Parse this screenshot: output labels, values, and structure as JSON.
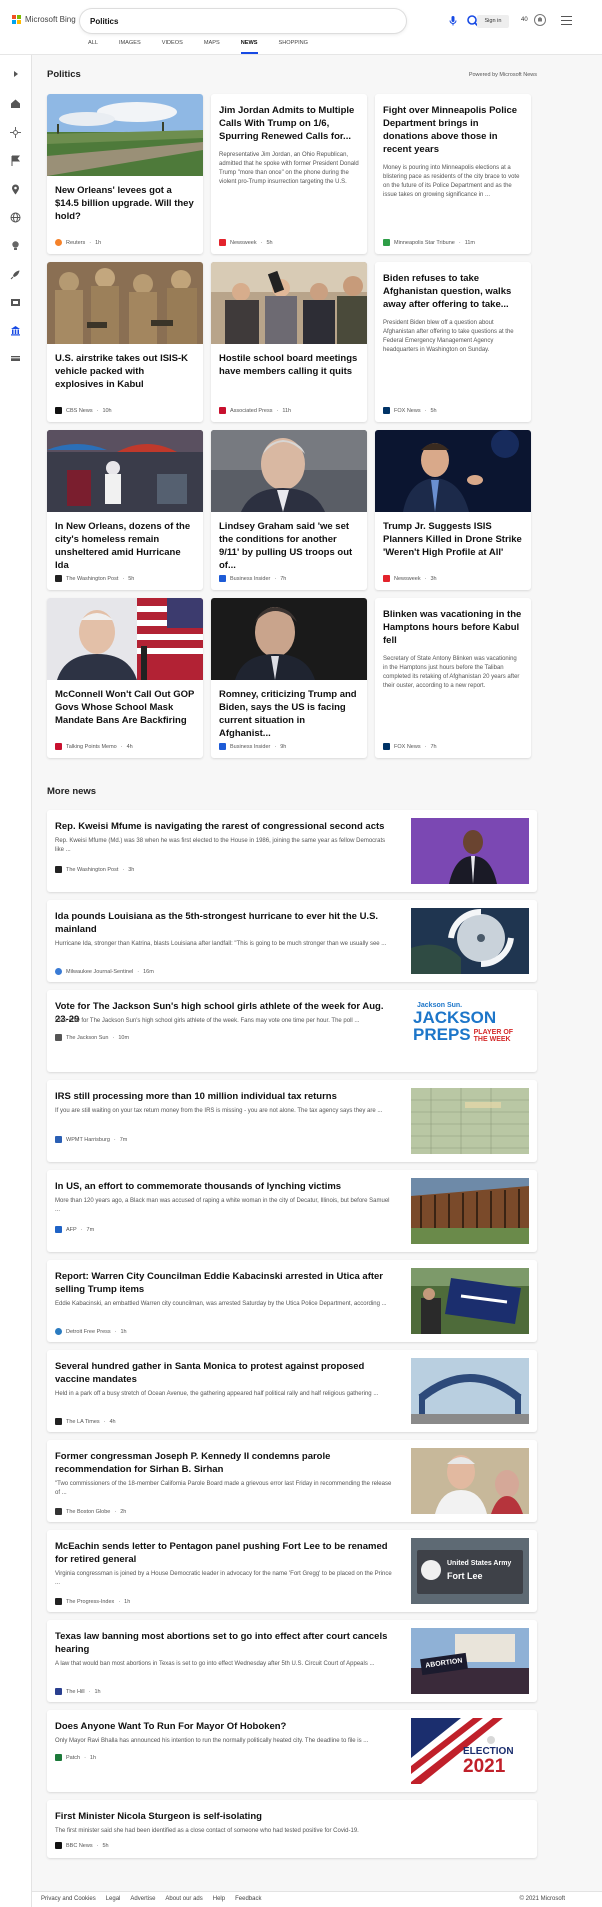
{
  "header": {
    "logo_text": "Microsoft Bing",
    "logo_colors": [
      "#f25022",
      "#7fba00",
      "#00a4ef",
      "#ffb900"
    ],
    "search_value": "Politics",
    "tabs": [
      {
        "label": "ALL",
        "active": false
      },
      {
        "label": "IMAGES",
        "active": false
      },
      {
        "label": "VIDEOS",
        "active": false
      },
      {
        "label": "MAPS",
        "active": false
      },
      {
        "label": "NEWS",
        "active": true
      },
      {
        "label": "SHOPPING",
        "active": false
      }
    ],
    "signin_label": "Sign in",
    "rewards_points": "40",
    "accent_color": "#174ae4"
  },
  "sidebar": {
    "icons": [
      "expand-icon",
      "home-icon",
      "crosshair-icon",
      "flag-icon",
      "location-pin-icon",
      "globe-icon",
      "lightbulb-icon",
      "rocket-icon",
      "film-icon",
      "politics-building-icon",
      "money-icon"
    ]
  },
  "main": {
    "section_title": "Politics",
    "powered_by": "Powered by Microsoft News",
    "cards": [
      {
        "title": "New Orleans' levees got a $14.5 billion upgrade. Will they hold?",
        "source": "Reuters",
        "age": "1h",
        "has_image": true,
        "image": "levee-photo",
        "src_color": "#f5822a"
      },
      {
        "title": "Jim Jordan Admits to Multiple Calls With Trump on 1/6, Spurring Renewed Calls for...",
        "desc": "Representative Jim Jordan, an Ohio Republican, admitted that he spoke with former President Donald Trump \"more than once\" on the phone during the violent pro-Trump insurrection targeting the U.S.",
        "source": "Newsweek",
        "age": "5h",
        "has_image": false,
        "src_color": "#e3232c"
      },
      {
        "title": "Fight over Minneapolis Police Department brings in donations above those in recent years",
        "desc": "Money is pouring into Minneapolis elections at a blistering pace as residents of the city brace to vote on the future of its Police Department and as the issue takes on growing significance in ...",
        "source": "Minneapolis Star Tribune",
        "age": "11m",
        "has_image": false,
        "src_color": "#2e9e47"
      },
      {
        "title": "U.S. airstrike takes out ISIS-K vehicle packed with explosives in Kabul",
        "source": "CBS News",
        "age": "10h",
        "has_image": true,
        "image": "soldiers-photo",
        "src_color": "#111111"
      },
      {
        "title": "Hostile school board meetings have members calling it quits",
        "source": "Associated Press",
        "age": "11h",
        "has_image": true,
        "image": "meeting-photo",
        "src_color": "#c8102e"
      },
      {
        "title": "Biden refuses to take Afghanistan question, walks away after offering to take...",
        "desc": "President Biden blew off a question about Afghanistan after offering to take questions at the Federal Emergency Management Agency headquarters in Washington on Sunday.",
        "source": "FOX News",
        "age": "5h",
        "has_image": false,
        "src_color": "#003366"
      },
      {
        "title": "In New Orleans, dozens of the city's homeless remain unsheltered amid Hurricane Ida",
        "source": "The Washington Post",
        "age": "5h",
        "has_image": true,
        "image": "homeless-photo",
        "src_color": "#222222"
      },
      {
        "title": "Lindsey Graham said 'we set the conditions for another 9/11' by pulling US troops out of...",
        "source": "Business Insider",
        "age": "7h",
        "has_image": true,
        "image": "graham-photo",
        "src_color": "#1d5bd6"
      },
      {
        "title": "Trump Jr. Suggests ISIS Planners Killed in Drone Strike 'Weren't High Profile at All'",
        "source": "Newsweek",
        "age": "3h",
        "has_image": true,
        "image": "trumpjr-photo",
        "src_color": "#e3232c"
      },
      {
        "title": "McConnell Won't Call Out GOP Govs Whose School Mask Mandate Bans Are Backfiring",
        "source": "Talking Points Memo",
        "age": "4h",
        "has_image": true,
        "image": "mcconnell-photo",
        "src_color": "#c8102e"
      },
      {
        "title": "Romney, criticizing Trump and Biden, says the US is facing current situation in Afghanist...",
        "source": "Business Insider",
        "age": "9h",
        "has_image": true,
        "image": "romney-photo",
        "src_color": "#1d5bd6"
      },
      {
        "title": "Blinken was vacationing in the Hamptons hours before Kabul fell",
        "desc": "Secretary of State Antony Blinken was vacationing in the Hamptons just hours before the Taliban completed its retaking of Afghanistan 20 years after their ouster, according to a new report.",
        "source": "FOX News",
        "age": "7h",
        "has_image": false,
        "src_color": "#003366"
      }
    ],
    "more_title": "More news",
    "more": [
      {
        "title": "Rep. Kweisi Mfume is navigating the rarest of congressional second acts",
        "desc": "Rep. Kweisi Mfume (Md.) was 38 when he was first elected to the House in 1986, joining the same year as fellow Democrats like ...",
        "source": "The Washington Post",
        "age": "3h",
        "image": "mfume-photo",
        "src_color": "#222222"
      },
      {
        "title": "Ida pounds Louisiana as the 5th-strongest hurricane to ever hit the U.S. mainland",
        "desc": "Hurricane Ida, stronger than Katrina, blasts Louisiana after landfall: \"This is going to be much stronger than we usually see ...",
        "source": "Milwaukee Journal-Sentinel",
        "age": "16m",
        "image": "hurricane-photo",
        "src_color": "#3a7bd5"
      },
      {
        "title": "Vote for The Jackson Sun's high school girls athlete of the week for Aug. 23-29",
        "desc": "Vote now for The Jackson Sun's high school girls athlete of the week. Fans may vote one time per hour. The poll ...",
        "source": "The Jackson Sun",
        "age": "10m",
        "image": "jackson-preps",
        "src_color": "#555555"
      },
      {
        "title": "IRS still processing more than 10 million individual tax returns",
        "desc": "If you are still waiting on your tax return money from the IRS is missing - you are not alone. The tax agency says they are ...",
        "source": "WPMT Harrisburg",
        "age": "7m",
        "image": "tax-form-photo",
        "src_color": "#2b5fb4"
      },
      {
        "title": "In US, an effort to commemorate thousands of lynching victims",
        "desc": "More than 120 years ago, a Black man was accused of raping a white woman in the city of Decatur, Illinois, but before Samuel ...",
        "source": "AFP",
        "age": "7m",
        "image": "memorial-photo",
        "src_color": "#1f63c6"
      },
      {
        "title": "Report: Warren City Councilman Eddie Kabacinski arrested in Utica after selling Trump items",
        "desc": "Eddie Kabacinski, an embattled Warren city councilman, was arrested Saturday by the Utica Police Department, according ...",
        "source": "Detroit Free Press",
        "age": "1h",
        "image": "trump-flag-photo",
        "src_color": "#2b7bc0"
      },
      {
        "title": "Several hundred gather in Santa Monica to protest against proposed vaccine mandates",
        "desc": "Held in a park off a busy stretch of Ocean Avenue, the gathering appeared half political rally and half religious gathering ...",
        "source": "The LA Times",
        "age": "4h",
        "image": "santa-monica-pier",
        "src_color": "#222222"
      },
      {
        "title": "Former congressman Joseph P. Kennedy II condemns parole recommendation for Sirhan B. Sirhan",
        "desc": "\"Two commissioners of the 18-member California Parole Board made a grievous error last Friday in recommending the release of ...",
        "source": "The Boston Globe",
        "age": "2h",
        "image": "kennedy-photo",
        "src_color": "#333333"
      },
      {
        "title": "McEachin sends letter to Pentagon panel pushing Fort Lee to be renamed for retired general",
        "desc": "Virginia congressman is joined by a House Democratic leader in advocacy for the name 'Fort Gregg' to be placed on the Prince ...",
        "source": "The Progress-Index",
        "age": "1h",
        "image": "fort-lee-sign",
        "src_color": "#222222"
      },
      {
        "title": "Texas law banning most abortions set to go into effect after court cancels hearing",
        "desc": "A law that would ban most abortions in Texas is set to go into effect Wednesday after 5th U.S. Circuit Court of Appeals ...",
        "source": "The Hill",
        "age": "1h",
        "image": "abortion-protest",
        "src_color": "#2a3f8f"
      },
      {
        "title": "Does Anyone Want To Run For Mayor Of Hoboken?",
        "desc": "Only Mayor Ravi Bhalla has announced his intention to run the normally politically heated city. The deadline to file is ...",
        "source": "Patch",
        "age": "1h",
        "image": "election-2021",
        "src_color": "#1c7a3a"
      },
      {
        "title": "First Minister Nicola Sturgeon is self-isolating",
        "desc": "The first minister said she had been identified as a close contact of someone who had tested positive for Covid-19.",
        "source": "BBC News",
        "age": "5h",
        "image": "",
        "src_color": "#111111"
      }
    ],
    "jackson_text": {
      "brand": "Jackson Sun.",
      "big1": "JACKSON",
      "big2": "PREPS",
      "sub1": "PLAYER OF",
      "sub2": "THE WEEK"
    },
    "fortlee_text": {
      "line1": "United States Army",
      "line2": "Fort Lee"
    },
    "election_text": {
      "line1": "ELECTION",
      "line2": "2021"
    },
    "abortion_text": "ABORTION"
  },
  "footer": {
    "links": [
      "Privacy and Cookies",
      "Legal",
      "Advertise",
      "About our ads",
      "Help",
      "Feedback"
    ],
    "copyright": "© 2021 Microsoft"
  }
}
